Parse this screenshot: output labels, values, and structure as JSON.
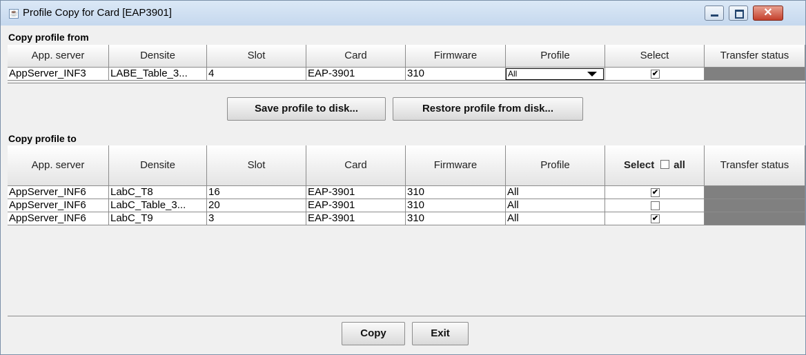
{
  "window": {
    "title": "Profile Copy for Card [EAP3901]",
    "controls": {
      "minimize": "minimize",
      "maximize": "maximize",
      "close": "close"
    }
  },
  "from": {
    "label": "Copy profile from",
    "columns": [
      "App. server",
      "Densite",
      "Slot",
      "Card",
      "Firmware",
      "Profile",
      "Select",
      "Transfer status"
    ],
    "row": {
      "app_server": "AppServer_INF3",
      "densite": "LABE_Table_3...",
      "slot": "4",
      "card": "EAP-3901",
      "firmware": "310",
      "profile": "All",
      "selected": true,
      "transfer_status": ""
    }
  },
  "buttons": {
    "save": "Save profile to disk...",
    "restore": "Restore profile from disk...",
    "copy": "Copy",
    "exit": "Exit"
  },
  "to": {
    "label": "Copy profile to",
    "columns": [
      "App. server",
      "Densite",
      "Slot",
      "Card",
      "Firmware",
      "Profile",
      "Select",
      "all",
      "Transfer status"
    ],
    "select_all_checked": false,
    "rows": [
      {
        "app_server": "AppServer_INF6",
        "densite": "LabC_T8",
        "slot": "16",
        "card": "EAP-3901",
        "firmware": "310",
        "profile": "All",
        "selected": true
      },
      {
        "app_server": "AppServer_INF6",
        "densite": "LabC_Table_3...",
        "slot": "20",
        "card": "EAP-3901",
        "firmware": "310",
        "profile": "All",
        "selected": false
      },
      {
        "app_server": "AppServer_INF6",
        "densite": "LabC_T9",
        "slot": "3",
        "card": "EAP-3901",
        "firmware": "310",
        "profile": "All",
        "selected": true
      }
    ]
  },
  "colors": {
    "status_fill": "#808080",
    "close_button": "#c4402c"
  }
}
